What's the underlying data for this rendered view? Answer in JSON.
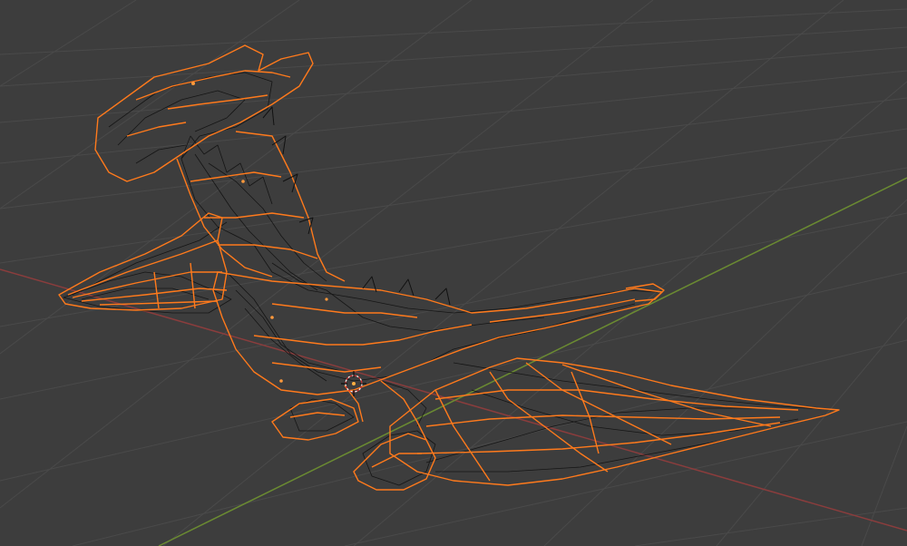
{
  "viewport": {
    "mode": "wireframe",
    "colors": {
      "background": "#3d3d3d",
      "grid": "#4a4a4a",
      "x_axis": "#8a3d3d",
      "y_axis": "#6a8a32",
      "selected_outline": "#ff7a1c",
      "mesh_edges": "#111111",
      "origin": "#ffffff"
    },
    "object": {
      "name": "dragon-mesh",
      "selected": true
    },
    "icons": [
      "3d-cursor-icon",
      "object-origin-icon"
    ]
  }
}
